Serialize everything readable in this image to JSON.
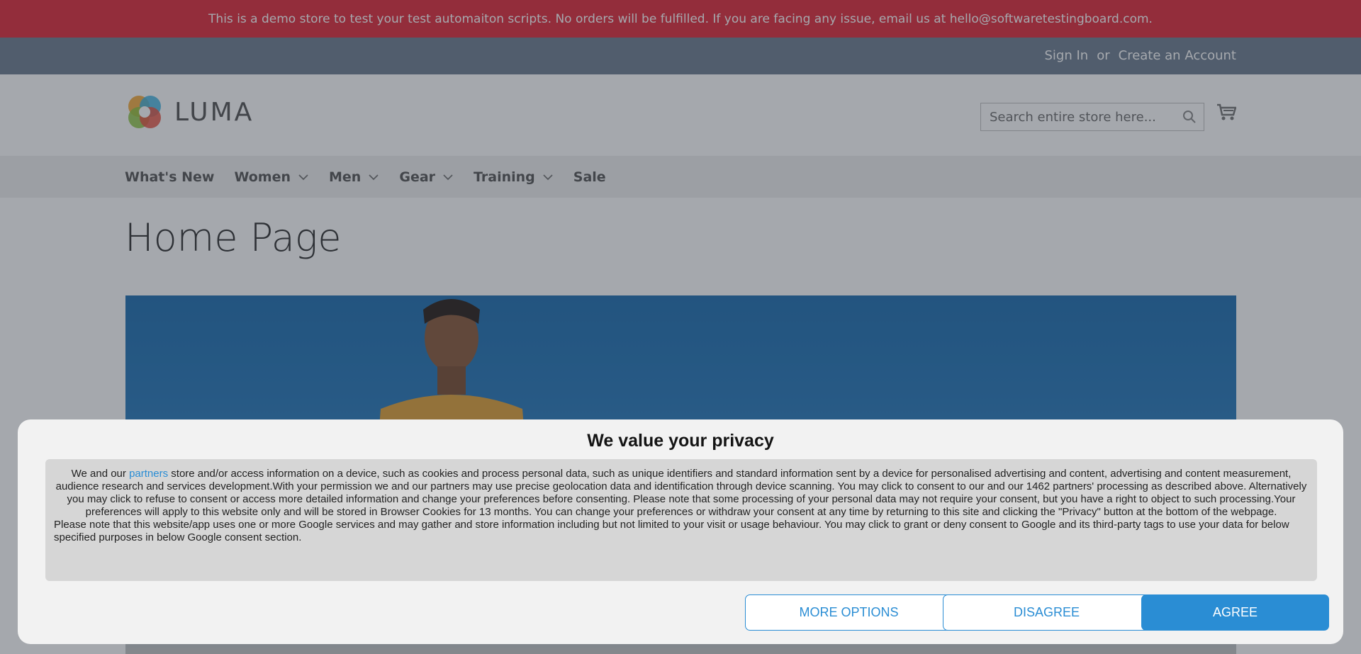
{
  "demo_notice": "This is a demo store to test your test automaiton scripts. No orders will be fulfilled. If you are facing any issue, email us at hello@softwaretestingboard.com.",
  "header": {
    "sign_in": "Sign In",
    "or": "or",
    "create_account": "Create an Account",
    "logo_text": "LUMA",
    "search_placeholder": "Search entire store here..."
  },
  "nav": {
    "items": [
      {
        "label": "What's New",
        "has_dropdown": false
      },
      {
        "label": "Women",
        "has_dropdown": true
      },
      {
        "label": "Men",
        "has_dropdown": true
      },
      {
        "label": "Gear",
        "has_dropdown": true
      },
      {
        "label": "Training",
        "has_dropdown": true
      },
      {
        "label": "Sale",
        "has_dropdown": false
      }
    ]
  },
  "page": {
    "title": "Home Page"
  },
  "consent": {
    "title": "We value your privacy",
    "text_prefix": "We and our ",
    "partners_link": "partners",
    "text_body": " store and/or access information on a device, such as cookies and process personal data, such as unique identifiers and standard information sent by a device for personalised advertising and content, advertising and content measurement, audience research and services development.With your permission we and our partners may use precise geolocation data and identification through device scanning. You may click to consent to our and our 1462 partners' processing as described above. Alternatively you may click to refuse to consent or access more detailed information and change your preferences before consenting. Please note that some processing of your personal data may not require your consent, but you have a right to object to such processing.Your preferences will apply to this website only and will be stored in Browser Cookies for 13 months. You can change your preferences or withdraw your consent at any time by returning to this site and clicking the \"Privacy\" button at the bottom of the webpage.",
    "text_google": "Please note that this website/app uses one or more Google services and may gather and store information including but not limited to your visit or usage behaviour. You may click to grant or deny consent to Google and its third-party tags to use your data for below specified purposes in below Google consent section.",
    "more_options": "MORE OPTIONS",
    "disagree": "DISAGREE",
    "agree": "AGREE"
  },
  "colors": {
    "demo_bar": "#e02b3c",
    "accent_blue": "#2a8dd4",
    "panel_header": "#6e7f92"
  }
}
